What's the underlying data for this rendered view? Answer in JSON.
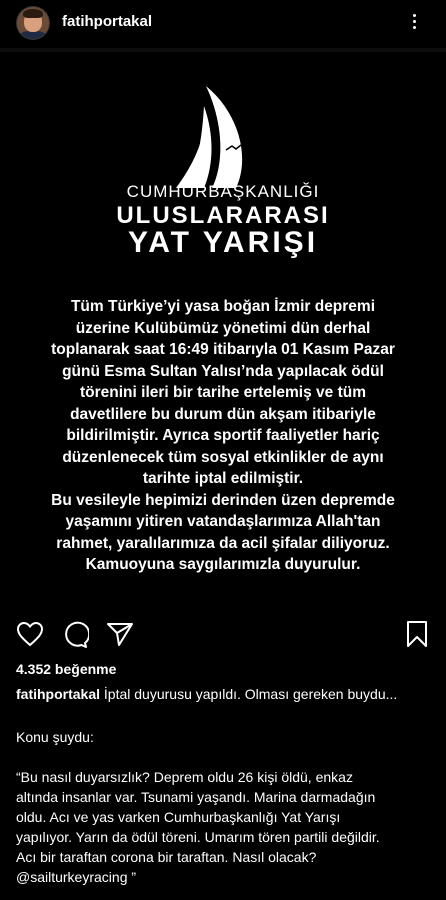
{
  "header": {
    "username": "fatihportakal"
  },
  "post": {
    "logo_line1": "CUMHURBAŞKANLIĞI",
    "logo_line2": "ULUSLARARASI",
    "logo_line3": "YAT YARIŞI",
    "announcement_lines": [
      "Tüm Türkiye’yi yasa boğan İzmir depremi",
      "üzerine Kulübümüz yönetimi dün derhal",
      "toplanarak saat 16:49 itibarıyla 01 Kasım Pazar",
      "günü Esma Sultan Yalısı’nda yapılacak ödül",
      "törenini ileri bir tarihe ertelemiş ve tüm",
      "davetlilere bu durum dün akşam itibariyle",
      "bildirilmiştir. Ayrıca sportif faaliyetler hariç",
      "düzenlenecek tüm sosyal etkinlikler de aynı",
      "tarihte iptal edilmiştir.",
      "Bu vesileyle hepimizi derinden üzen depremde",
      "yaşamını yitiren vatandaşlarımıza Allah'tan",
      "rahmet, yaralılarımıza da acil şifalar diliyoruz.",
      "Kamuoyuna saygılarımızla duyurulur."
    ]
  },
  "actions": {
    "like_icon": "heart-icon",
    "comment_icon": "comment-icon",
    "share_icon": "send-icon",
    "save_icon": "bookmark-icon"
  },
  "likes_text": "4.352 beğenme",
  "caption": {
    "username": "fatihportakal",
    "text": "İptal duyurusu yapıldı. Olması gereken buydu..."
  },
  "body": {
    "para1": "Konu şuydu:",
    "para2_lines": [
      "“Bu nasıl duyarsızlık? Deprem oldu 26 kişi öldü, enkaz",
      "altında insanlar var. Tsunami yaşandı. Marina darmadağın",
      "oldu. Acı ve yas varken Cumhurbaşkanlığı Yat Yarışı",
      "yapılıyor. Yarın da ödül töreni. Umarım tören partili değildir.",
      "Acı bir taraftan corona bir taraftan. Nasıl olacak?",
      "@sailturkeyracing ”"
    ]
  }
}
